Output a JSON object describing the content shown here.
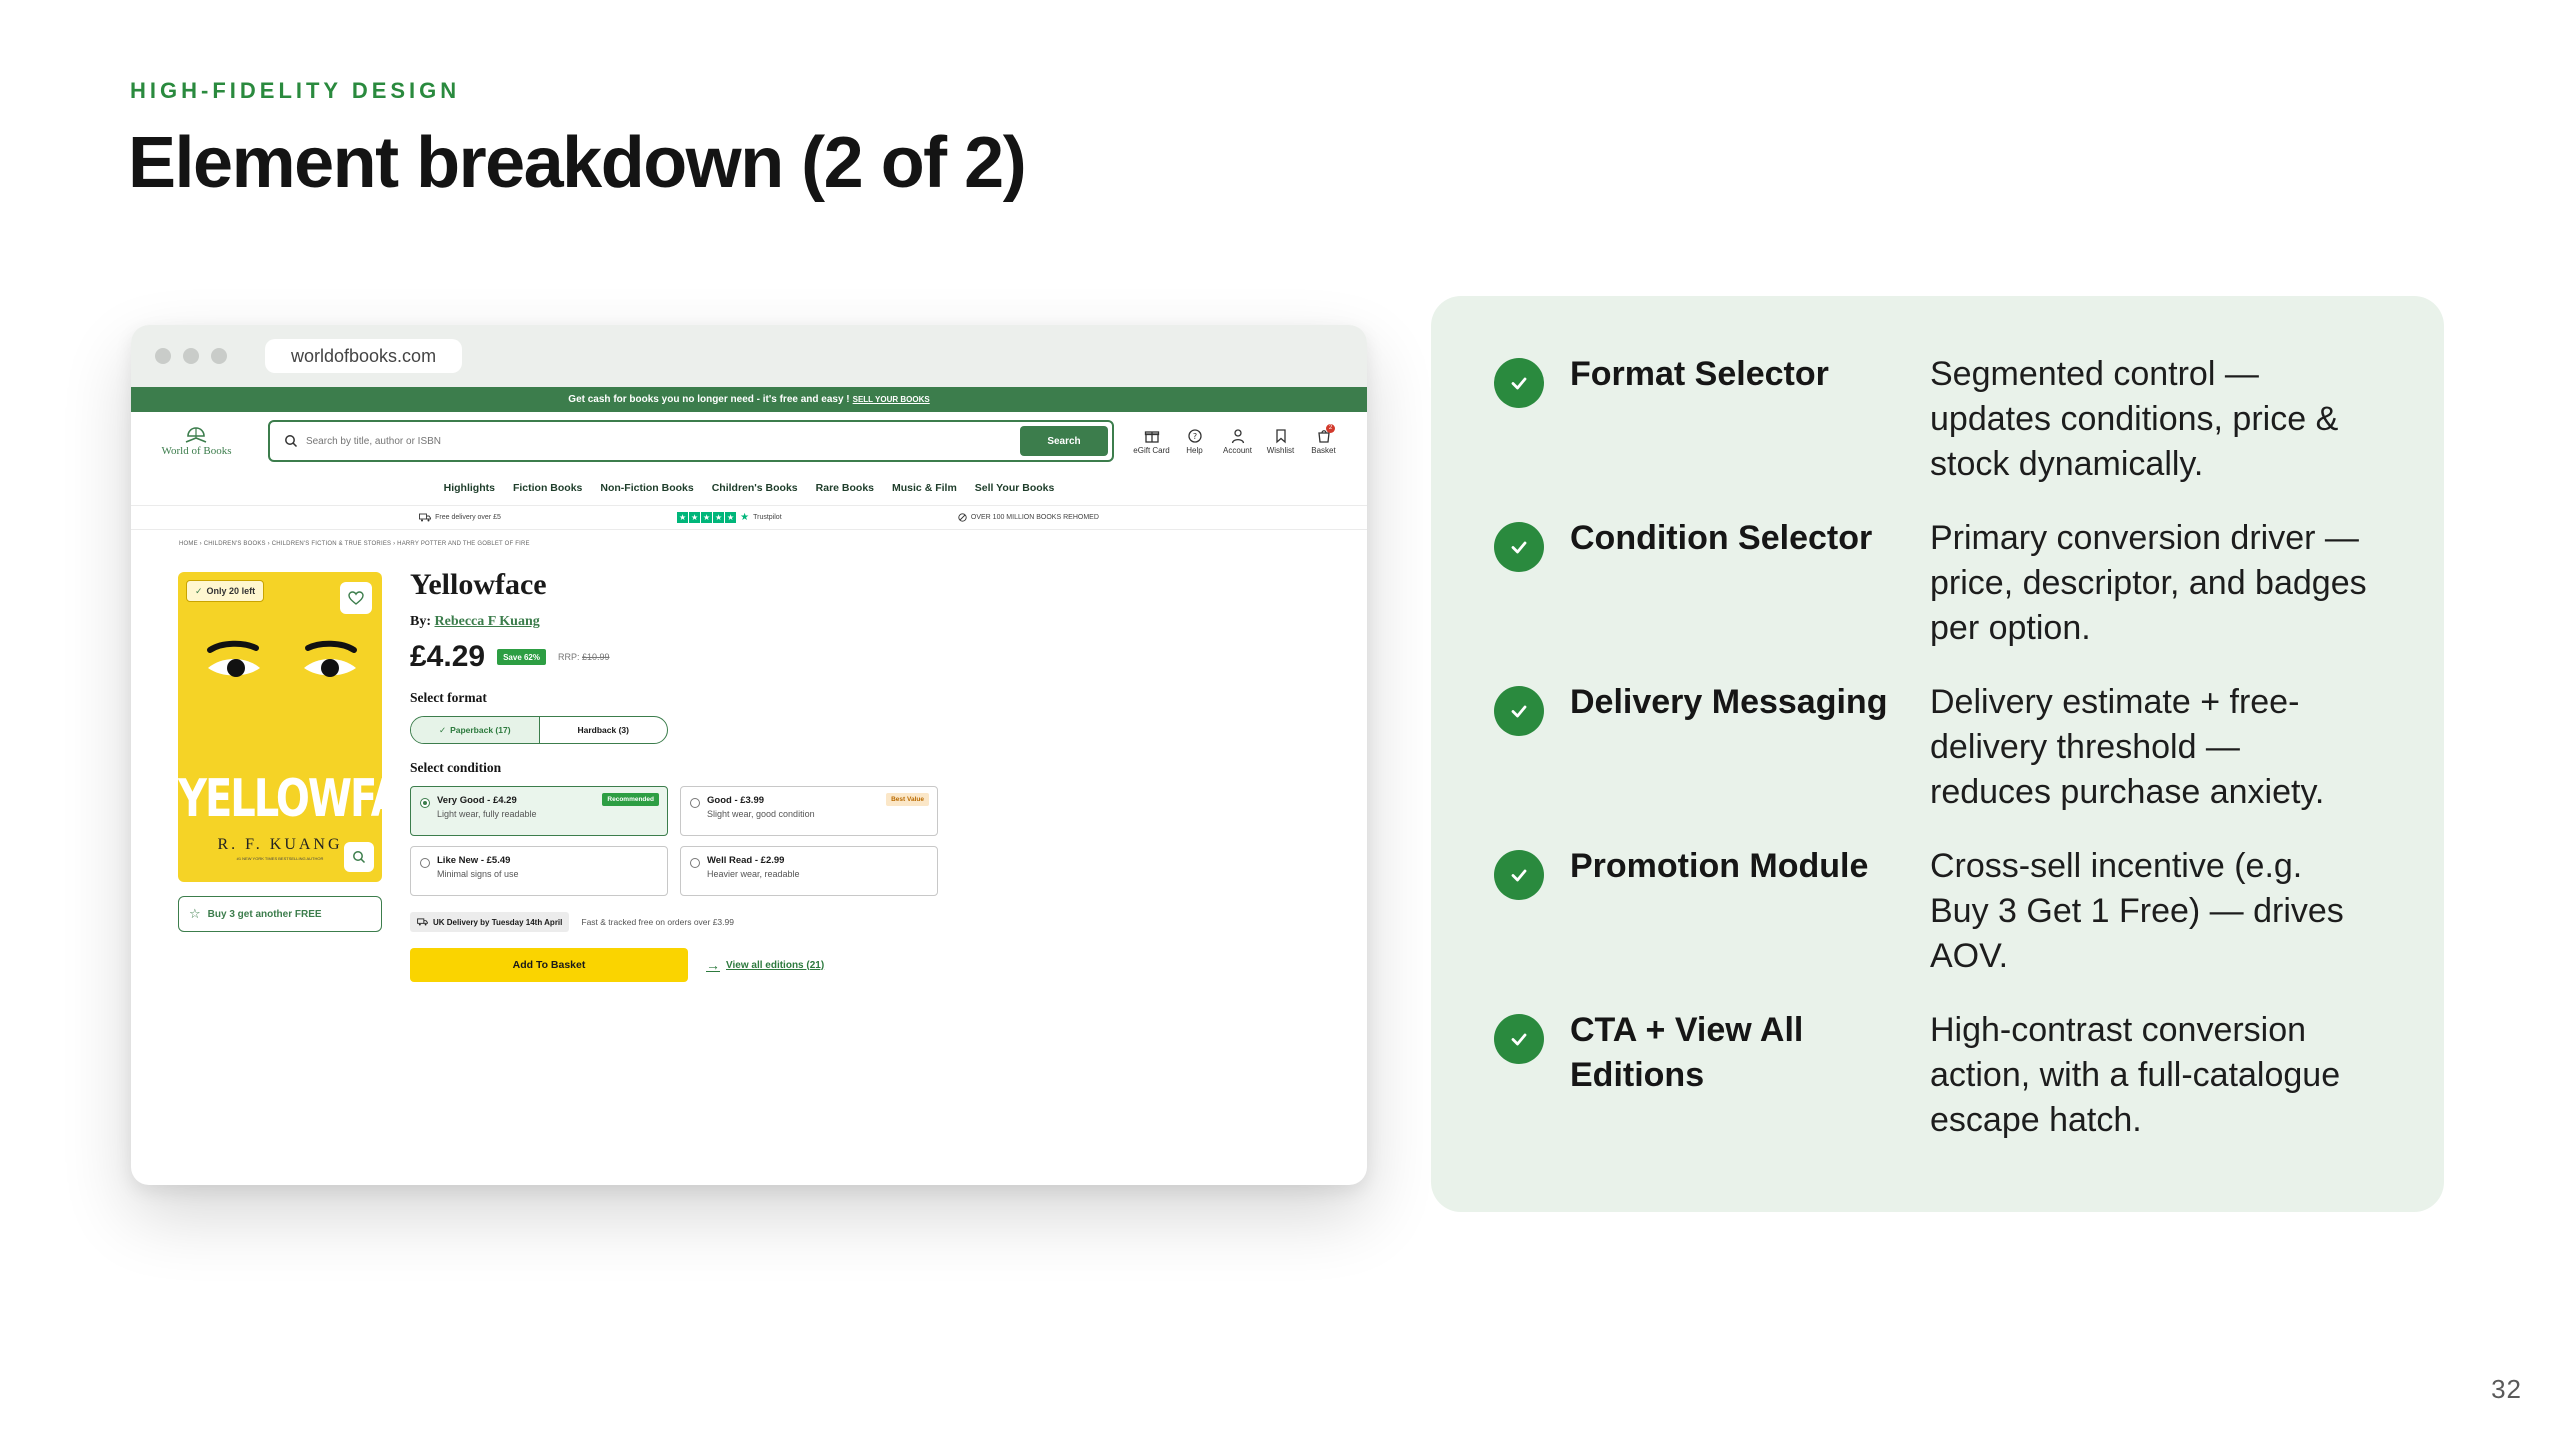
{
  "slide": {
    "eyebrow": "HIGH-FIDELITY DESIGN",
    "title": "Element breakdown (2 of 2)",
    "page_number": "32"
  },
  "browser": {
    "url": "worldofbooks.com",
    "promo_text": "Get cash for books you no longer need - it's free and easy !",
    "promo_link": "SELL YOUR BOOKS",
    "logo_text": "World of Books",
    "search_placeholder": "Search by title, author or ISBN",
    "search_button": "Search",
    "header_icons": [
      {
        "label": "eGift Card",
        "icon": "gift-icon"
      },
      {
        "label": "Help",
        "icon": "help-icon"
      },
      {
        "label": "Account",
        "icon": "user-icon"
      },
      {
        "label": "Wishlist",
        "icon": "bookmark-icon"
      },
      {
        "label": "Basket",
        "icon": "basket-icon"
      }
    ],
    "basket_count": "2",
    "nav": [
      "Highlights",
      "Fiction Books",
      "Non-Fiction Books",
      "Children's Books",
      "Rare Books",
      "Music & Film",
      "Sell Your Books"
    ],
    "usps": {
      "delivery": "Free delivery over £5",
      "trustpilot": "Trustpilot",
      "rehomed": "OVER 100 MILLION BOOKS REHOMED"
    },
    "breadcrumb": "HOME  ›  CHILDREN'S BOOKS  ›  CHILDREN'S FICTION & TRUE STORIES  ›  HARRY POTTER AND THE GOBLET OF FIRE"
  },
  "product": {
    "stock_tag": "Only 20 left",
    "cover_title": "YELLOWFACE",
    "cover_author": "R. F. KUANG",
    "cover_tagline": "#1 NEW YORK TIMES BESTSELLING AUTHOR",
    "promo_chip": "Buy 3 get another FREE",
    "title": "Yellowface",
    "by_label": "By:",
    "author": "Rebecca F Kuang",
    "price": "£4.29",
    "save_badge": "Save 62%",
    "rrp_label": "RRP:",
    "rrp_value": "£10.99",
    "format_label": "Select format",
    "formats": [
      {
        "label": "Paperback (17)",
        "active": true
      },
      {
        "label": "Hardback (3)",
        "active": false
      }
    ],
    "condition_label": "Select condition",
    "conditions": [
      {
        "name": "Very Good - £4.29",
        "desc": "Light wear, fully readable",
        "badge": "Recommended"
      },
      {
        "name": "Good - £3.99",
        "desc": "Slight wear, good condition",
        "badge": "Best Value"
      },
      {
        "name": "Like New - £5.49",
        "desc": "Minimal signs of use",
        "badge": ""
      },
      {
        "name": "Well Read - £2.99",
        "desc": "Heavier wear, readable",
        "badge": ""
      }
    ],
    "delivery_pill": "UK Delivery by Tuesday 14th April",
    "delivery_note": "Fast & tracked free on orders over £3.99",
    "add_to_basket": "Add To Basket",
    "view_all": "View all editions (21)"
  },
  "features": [
    {
      "name": "Format Selector",
      "desc": "Segmented control — updates conditions, price & stock dynamically."
    },
    {
      "name": "Condition Selector",
      "desc": "Primary conversion driver — price, descriptor, and badges per option."
    },
    {
      "name": "Delivery Messaging",
      "desc": "Delivery estimate + free-delivery threshold — reduces purchase anxiety."
    },
    {
      "name": "Promotion Module",
      "desc": "Cross-sell incentive (e.g. Buy 3 Get 1 Free) — drives AOV."
    },
    {
      "name": "CTA + View All Editions",
      "desc": "High-contrast conversion action, with a full-catalogue escape hatch."
    }
  ],
  "colors": {
    "brand_green": "#3c7d4c",
    "accent_green": "#2a8a3e",
    "panel_bg": "#e9f2ea",
    "cta_yellow": "#fad400",
    "cover_yellow": "#f5d326"
  }
}
